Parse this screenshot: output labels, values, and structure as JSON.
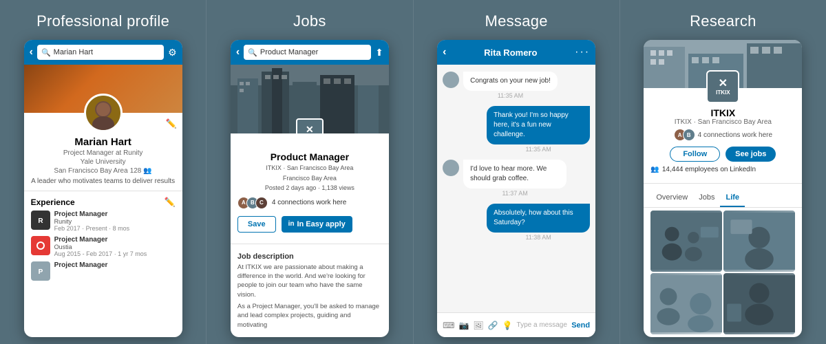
{
  "sections": [
    {
      "id": "professional-profile",
      "title": "Professional profile",
      "topbar": {
        "search_text": "Marian Hart",
        "back": "‹",
        "settings": "⚙"
      },
      "profile": {
        "name": "Marian Hart",
        "title": "Project Manager at Runity",
        "university": "Yale University",
        "location": "San Francisco Bay Area",
        "connections": "128",
        "description": "A leader who motivates teams to deliver results",
        "experience_label": "Experience",
        "experiences": [
          {
            "title": "Project Manager",
            "company": "Runity",
            "dates": "Feb 2017 · Present · 8 mos",
            "logo_text": "R",
            "color": "dark"
          },
          {
            "title": "Project Manager",
            "company": "Oustia",
            "dates": "Aug 2015 - Feb 2017 · 1 yr 7 mos",
            "logo_text": "O",
            "color": "red"
          },
          {
            "title": "Project Manager",
            "company": "",
            "dates": "",
            "logo_text": "P",
            "color": "gray"
          }
        ]
      }
    },
    {
      "id": "jobs",
      "title": "Jobs",
      "topbar": {
        "search_text": "Product Manager",
        "back": "‹"
      },
      "job": {
        "title": "Product Manager",
        "company": "ITKIX",
        "location": "San Francisco Bay Area",
        "area": "Francisco Bay Area",
        "posted": "Posted 2 days ago · 1,138 views",
        "connections": "4 connections work here",
        "save_label": "Save",
        "apply_label": "In Easy apply",
        "description_title": "Job description",
        "description": "At ITKIX we are passionate about making a difference in the world. And we're looking for people to join our team who have the same vision.",
        "description2": "As a Project Manager, you'll be asked to manage and lead complex projects, guiding and motivating"
      }
    },
    {
      "id": "message",
      "title": "Message",
      "topbar": {
        "contact": "Rita Romero",
        "back": "‹",
        "dots": "···"
      },
      "messages": [
        {
          "type": "received",
          "text": "Congrats on your new job!",
          "time": "11:35 AM"
        },
        {
          "type": "sent",
          "text": "Thank you! I'm so happy here, it's a fun new challenge.",
          "time": "11:35 AM"
        },
        {
          "type": "received",
          "text": "I'd love to hear more. We should grab coffee.",
          "time": "11:37 AM"
        },
        {
          "type": "sent",
          "text": "Absolutely, how about this Saturday?",
          "time": "11:38 AM"
        }
      ],
      "input_placeholder": "Type a message",
      "send_label": "Send"
    },
    {
      "id": "research",
      "title": "Research",
      "company": {
        "name": "ITKIX",
        "subtitle": "ITKIX · San Francisco Bay Area",
        "connections": "4 connections work here",
        "follow_label": "Follow",
        "see_jobs_label": "See jobs",
        "employees": "14,444 employees on LinkedIn",
        "tabs": [
          "Overview",
          "Jobs",
          "Life"
        ],
        "active_tab": "Life"
      }
    }
  ]
}
